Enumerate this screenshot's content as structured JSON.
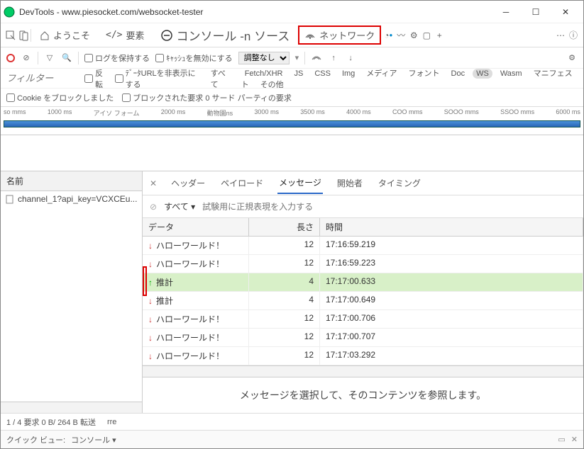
{
  "title": "DevTools - www.piesocket.com/websocket-tester",
  "mainTabs": {
    "welcome": "ようこそ",
    "elements": "要素",
    "console": "コンソール -n ソース",
    "network": "ネットワーク"
  },
  "toolbar": {
    "preserve": "ログを保持する",
    "disableCache": "ｷｬｯｼｭを無効にする",
    "throttle": "調整なし"
  },
  "filter": {
    "placeholder": "フィルター",
    "invert": "反転",
    "dataUrls": "ﾃﾞｰﾀURLを非表示にする",
    "all": "すべて",
    "types": [
      "Fetch/XHR",
      "JS",
      "CSS",
      "Img",
      "メディア",
      "フォント",
      "Doc",
      "WS",
      "Wasm",
      "マニフェスト",
      "その他"
    ]
  },
  "filter2": {
    "blocked": "Cookie をブロックしました",
    "blockedReq": "ブロックされた要求 0 サード パーティの要求"
  },
  "timeline": [
    "so mms",
    "1000 ms",
    "アイソ フォーム",
    "2000 ms",
    "動物園ns",
    "3000 ms",
    "3500 ms",
    "4000 ms",
    "COO mms",
    "SOOO mms",
    "SSOO mms",
    "6000 ms"
  ],
  "leftHeader": "名前",
  "leftRow": "channel_1?api_key=VCXCEu...",
  "rightTabs": {
    "header": "ヘッダー",
    "payload": "ペイロード",
    "messages": "メッセージ",
    "initiator": "開始者",
    "timing": "タイミング"
  },
  "rfilter": {
    "all": "すべて",
    "ph": "試験用に正規表現を入力する"
  },
  "cols": {
    "data": "データ",
    "len": "長さ",
    "time": "時間"
  },
  "rows": [
    {
      "d": "ハローワールド！",
      "l": "12",
      "t": "17:16:59.219",
      "dir": "down"
    },
    {
      "d": "ハローワールド！",
      "l": "12",
      "t": "17:16:59.223",
      "dir": "down"
    },
    {
      "d": "推計",
      "l": "4",
      "t": "17:17:00.633",
      "dir": "up",
      "hl": true
    },
    {
      "d": "推計",
      "l": "4",
      "t": "17:17:00.649",
      "dir": "down"
    },
    {
      "d": "ハローワールド！",
      "l": "12",
      "t": "17:17:00.706",
      "dir": "down"
    },
    {
      "d": "ハローワールド！",
      "l": "12",
      "t": "17:17:00.707",
      "dir": "down"
    },
    {
      "d": "ハローワールド！",
      "l": "12",
      "t": "17:17:03.292",
      "dir": "down"
    }
  ],
  "emptyMsg": "メッセージを選択して、そのコンテンツを参照します。",
  "status": {
    "req": "1 / 4 要求 0 B/ 264 B 転送",
    "res": "rre"
  },
  "qview": {
    "label": "クイック ビュー:",
    "sel": "コンソール"
  }
}
